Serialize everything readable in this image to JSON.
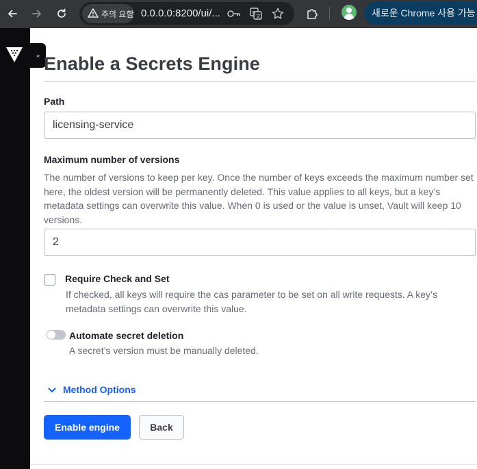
{
  "browser": {
    "security_chip": "주의 요함",
    "url": "0.0.0.0:8200/ui/...",
    "chrome_update": "새로운 Chrome 사용 가능"
  },
  "page": {
    "title": "Enable a Secrets Engine"
  },
  "form": {
    "path": {
      "label": "Path",
      "value": "licensing-service"
    },
    "max_versions": {
      "label": "Maximum number of versions",
      "help": "The number of versions to keep per key. Once the number of keys exceeds the maximum number set here, the oldest version will be permanently deleted. This value applies to all keys, but a key’s metadata settings can overwrite this value. When 0 is used or the value is unset, Vault will keep 10 versions.",
      "value": "2"
    },
    "cas": {
      "label": "Require Check and Set",
      "help": "If checked, all keys will require the cas parameter to be set on all write requests. A key’s metadata settings can overwrite this value.",
      "checked": false
    },
    "auto_delete": {
      "label": "Automate secret deletion",
      "help": "A secret’s version must be manually deleted.",
      "enabled": false
    },
    "method_options": "Method Options"
  },
  "actions": {
    "enable": "Enable engine",
    "back": "Back"
  },
  "colors": {
    "primary": "#1563ff",
    "link": "#1060ff",
    "sidebar": "#0c0c0e"
  }
}
